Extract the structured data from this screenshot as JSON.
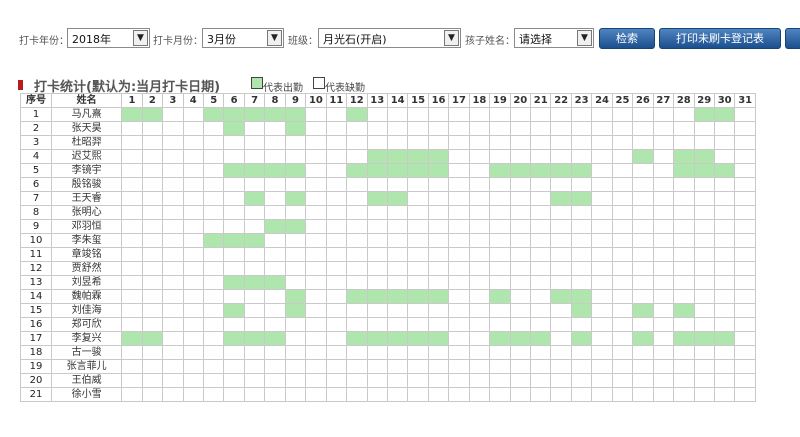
{
  "filters": {
    "year_label": "打卡年份：",
    "year_value": "2018年",
    "month_label": "打卡月份：",
    "month_value": "3月份",
    "class_label": "班级：",
    "class_value": "月光石(开启)",
    "child_label": "孩子姓名：",
    "child_value": "请选择",
    "search_button": "检索",
    "print_button": "打印未刷卡登记表"
  },
  "section": {
    "title": "打卡统计(默认为:当月打卡日期)",
    "legend_present": "代表出勤",
    "legend_absent": "代表缺勤"
  },
  "colors": {
    "present": "#aee6ad",
    "button": "#1b4f8e",
    "title_mark": "#b91c1c"
  },
  "table": {
    "headers": {
      "index": "序号",
      "name": "姓名",
      "days": [
        "1",
        "2",
        "3",
        "4",
        "5",
        "6",
        "7",
        "8",
        "9",
        "10",
        "11",
        "12",
        "13",
        "14",
        "15",
        "16",
        "17",
        "18",
        "19",
        "20",
        "21",
        "22",
        "23",
        "24",
        "25",
        "26",
        "27",
        "28",
        "29",
        "30",
        "31"
      ]
    },
    "rows": [
      {
        "no": "1",
        "name": "马凡熹",
        "present": [
          1,
          2,
          5,
          6,
          7,
          8,
          9,
          12,
          29,
          30
        ]
      },
      {
        "no": "2",
        "name": "张天昊",
        "present": [
          6,
          9
        ]
      },
      {
        "no": "3",
        "name": "杜昭羿",
        "present": []
      },
      {
        "no": "4",
        "name": "迟艾熙",
        "present": [
          13,
          14,
          15,
          16,
          26,
          28,
          29
        ]
      },
      {
        "no": "5",
        "name": "李镜宇",
        "present": [
          6,
          7,
          8,
          9,
          12,
          13,
          14,
          15,
          16,
          19,
          20,
          21,
          22,
          23,
          28,
          29,
          30
        ]
      },
      {
        "no": "6",
        "name": "殷铭骏",
        "present": []
      },
      {
        "no": "7",
        "name": "王天睿",
        "present": [
          7,
          9,
          13,
          14,
          22,
          23
        ]
      },
      {
        "no": "8",
        "name": "张明心",
        "present": []
      },
      {
        "no": "9",
        "name": "邓羽恒",
        "present": [
          8,
          9
        ]
      },
      {
        "no": "10",
        "name": "李朱玺",
        "present": [
          5,
          6,
          7
        ]
      },
      {
        "no": "11",
        "name": "章竣铭",
        "present": []
      },
      {
        "no": "12",
        "name": "贾舒然",
        "present": []
      },
      {
        "no": "13",
        "name": "刘昱希",
        "present": [
          6,
          7,
          8
        ]
      },
      {
        "no": "14",
        "name": "魏帕霖",
        "present": [
          9,
          12,
          13,
          14,
          15,
          16,
          19,
          22,
          23
        ]
      },
      {
        "no": "15",
        "name": "刘佳海",
        "present": [
          6,
          9,
          23,
          26,
          28
        ]
      },
      {
        "no": "16",
        "name": "郑可欣",
        "present": []
      },
      {
        "no": "17",
        "name": "李复兴",
        "present": [
          1,
          2,
          6,
          7,
          8,
          12,
          13,
          14,
          15,
          16,
          19,
          20,
          21,
          23,
          26,
          28,
          29,
          30
        ]
      },
      {
        "no": "18",
        "name": "古一骏",
        "present": []
      },
      {
        "no": "19",
        "name": "张言菲儿",
        "present": []
      },
      {
        "no": "20",
        "name": "王伯威",
        "present": []
      },
      {
        "no": "21",
        "name": "徐小雪",
        "present": []
      }
    ]
  }
}
